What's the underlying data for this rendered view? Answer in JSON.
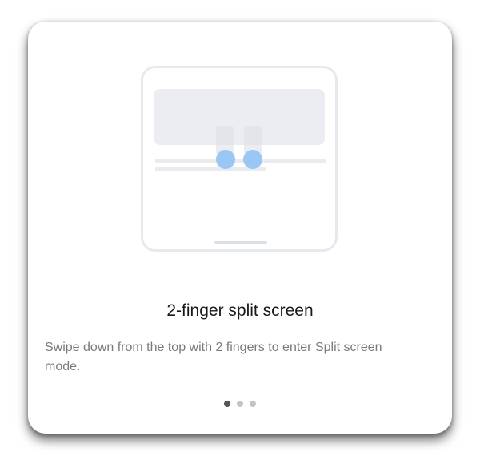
{
  "dialog": {
    "title": "2-finger split screen",
    "description": "Swipe down from the top with 2 fingers to enter Split screen mode."
  },
  "illustration": {
    "icon": "two-finger-swipe-down-illustration",
    "finger_color": "#91c2f5"
  },
  "pager": {
    "pages": 3,
    "current_page": 1,
    "active_color": "#555555",
    "inactive_color": "#c4c4c4"
  }
}
